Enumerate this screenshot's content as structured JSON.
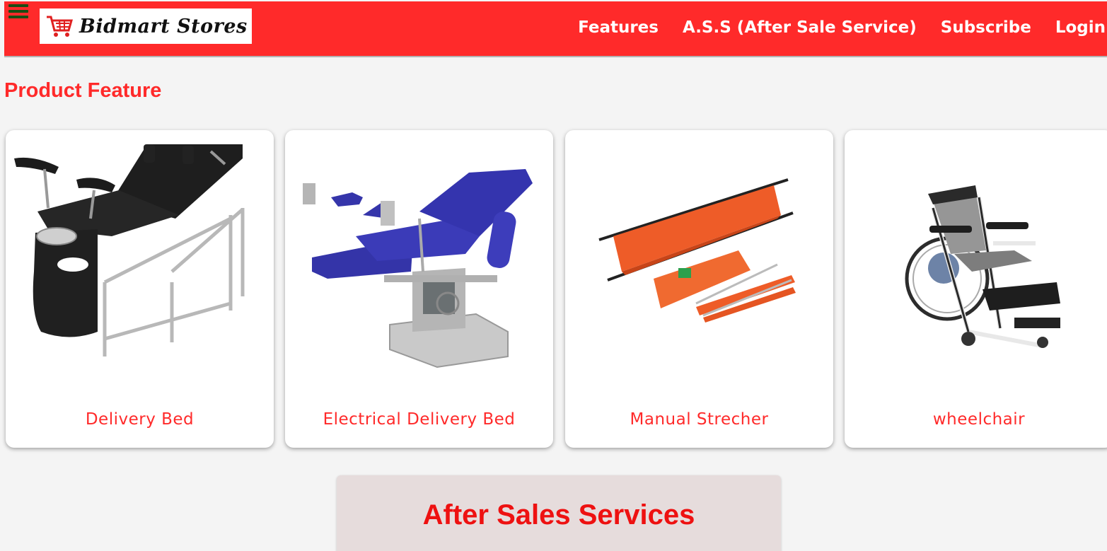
{
  "header": {
    "logo_text": "Bidmart Stores",
    "nav": [
      "Features",
      "A.S.S (After Sale Service)",
      "Subscribe",
      "Login"
    ]
  },
  "main": {
    "section_title": "Product Feature",
    "products": [
      {
        "label": "Delivery Bed",
        "icon": "delivery-bed-image"
      },
      {
        "label": "Electrical Delivery Bed",
        "icon": "electrical-delivery-bed-image"
      },
      {
        "label": "Manual Strecher",
        "icon": "stretcher-image"
      },
      {
        "label": "wheelchair",
        "icon": "wheelchair-image"
      }
    ]
  },
  "after_sales": {
    "title": "After Sales Services"
  },
  "colors": {
    "brand_red": "#ff2a2a",
    "menu_green": "#1a4d14",
    "ass_bg": "#e6dcdc"
  }
}
